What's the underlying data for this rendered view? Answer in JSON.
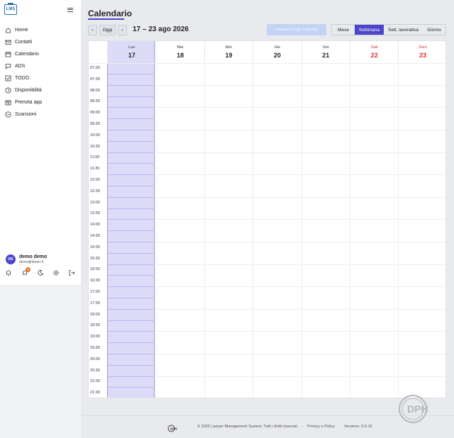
{
  "app": {
    "logo_text": "LMS"
  },
  "sidebar": {
    "items": [
      {
        "label": "Home",
        "icon": "home-icon"
      },
      {
        "label": "Contatti",
        "icon": "mail-icon"
      },
      {
        "label": "Calendario",
        "icon": "calendar-icon"
      },
      {
        "label": "ADS",
        "icon": "chat-icon"
      },
      {
        "label": "TODO",
        "icon": "checkbox-icon"
      },
      {
        "label": "Disponibilità",
        "icon": "clock-icon"
      },
      {
        "label": "Prenota app",
        "icon": "calendar-plus-icon"
      },
      {
        "label": "Scansioni",
        "icon": "scan-icon"
      }
    ],
    "user": {
      "initials": "DD",
      "name": "demo demo",
      "email": "demo@demo.it"
    },
    "notification_count": "4"
  },
  "header": {
    "title": "Calendario",
    "prev_label": "‹",
    "today_label": "Oggi",
    "next_label": "›",
    "range": "17 – 23 ago 2026",
    "google_button": "Collega Google Calendar",
    "views": [
      "Mese",
      "Settimana",
      "Sett. lavorativa",
      "Giorno"
    ],
    "active_view": "Settimana"
  },
  "calendar": {
    "days": [
      {
        "name": "Lun",
        "num": "17",
        "today": true,
        "weekend": false
      },
      {
        "name": "Mar",
        "num": "18",
        "today": false,
        "weekend": false
      },
      {
        "name": "Mer",
        "num": "19",
        "today": false,
        "weekend": false
      },
      {
        "name": "Gio",
        "num": "20",
        "today": false,
        "weekend": false
      },
      {
        "name": "Ven",
        "num": "21",
        "today": false,
        "weekend": false
      },
      {
        "name": "Sab",
        "num": "22",
        "today": false,
        "weekend": true
      },
      {
        "name": "Dom",
        "num": "23",
        "today": false,
        "weekend": true
      }
    ],
    "times": [
      "07:00",
      "07:30",
      "08:00",
      "08:30",
      "09:00",
      "09:30",
      "10:00",
      "10:30",
      "11:00",
      "11:30",
      "12:00",
      "12:30",
      "13:00",
      "13:30",
      "14:00",
      "14:30",
      "15:00",
      "15:30",
      "16:00",
      "16:30",
      "17:00",
      "17:30",
      "18:00",
      "18:30",
      "19:00",
      "19:30",
      "20:00",
      "20:30",
      "21:00",
      "21:30"
    ],
    "today_color": "#dcdcf8",
    "weekend_color": "#d9302c"
  },
  "footer": {
    "copyright": "© 2026 Lawyer Management System. Tutti i diritti riservati.",
    "sep": "·",
    "privacy": "Privacy e Policy",
    "version": "Versione: 5.9.16",
    "logo_text": "DPH"
  },
  "colors": {
    "accent": "#4c44c9",
    "badge": "#e8742c"
  }
}
